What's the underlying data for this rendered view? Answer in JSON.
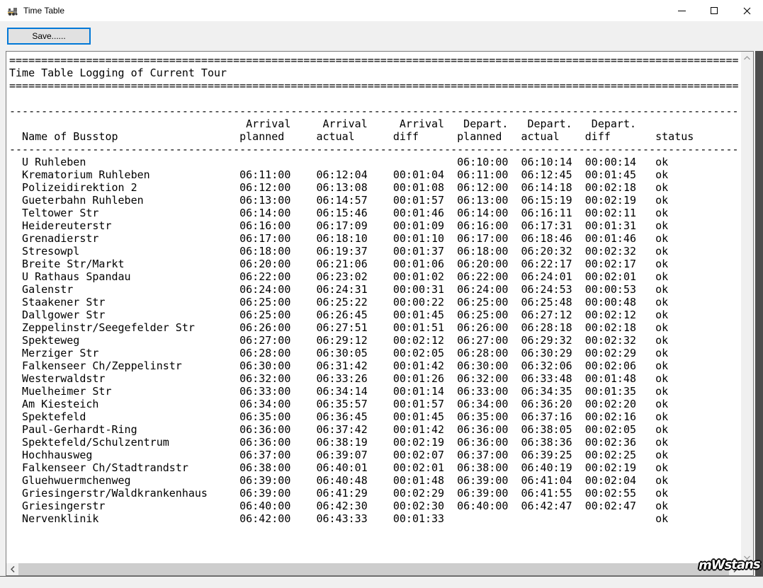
{
  "window": {
    "title": "Time Table"
  },
  "toolbar": {
    "save_label": "Save......"
  },
  "report": {
    "title_line": "Time Table Logging of Current Tour",
    "separator_heavy": {
      "char": "=",
      "count": 114
    },
    "separator_light": {
      "char": "-",
      "count": 114
    },
    "columns": {
      "name_header": "Name of Busstop",
      "groups": [
        [
          "Arrival",
          "planned"
        ],
        [
          "Arrival",
          "actual"
        ],
        [
          "Arrival",
          "diff"
        ],
        [
          "Depart.",
          "planned"
        ],
        [
          "Depart.",
          "actual"
        ],
        [
          "Depart.",
          "diff"
        ]
      ],
      "status_header": "status"
    },
    "rows": [
      [
        "U Ruhleben",
        "",
        "",
        "",
        "06:10:00",
        "06:10:14",
        "00:00:14",
        "ok"
      ],
      [
        "Krematorium Ruhleben",
        "06:11:00",
        "06:12:04",
        "00:01:04",
        "06:11:00",
        "06:12:45",
        "00:01:45",
        "ok"
      ],
      [
        "Polizeidirektion 2",
        "06:12:00",
        "06:13:08",
        "00:01:08",
        "06:12:00",
        "06:14:18",
        "00:02:18",
        "ok"
      ],
      [
        "Gueterbahn Ruhleben",
        "06:13:00",
        "06:14:57",
        "00:01:57",
        "06:13:00",
        "06:15:19",
        "00:02:19",
        "ok"
      ],
      [
        "Teltower Str",
        "06:14:00",
        "06:15:46",
        "00:01:46",
        "06:14:00",
        "06:16:11",
        "00:02:11",
        "ok"
      ],
      [
        "Heidereuterstr",
        "06:16:00",
        "06:17:09",
        "00:01:09",
        "06:16:00",
        "06:17:31",
        "00:01:31",
        "ok"
      ],
      [
        "Grenadierstr",
        "06:17:00",
        "06:18:10",
        "00:01:10",
        "06:17:00",
        "06:18:46",
        "00:01:46",
        "ok"
      ],
      [
        "Stresowpl",
        "06:18:00",
        "06:19:37",
        "00:01:37",
        "06:18:00",
        "06:20:32",
        "00:02:32",
        "ok"
      ],
      [
        "Breite Str/Markt",
        "06:20:00",
        "06:21:06",
        "00:01:06",
        "06:20:00",
        "06:22:17",
        "00:02:17",
        "ok"
      ],
      [
        "U Rathaus Spandau",
        "06:22:00",
        "06:23:02",
        "00:01:02",
        "06:22:00",
        "06:24:01",
        "00:02:01",
        "ok"
      ],
      [
        "Galenstr",
        "06:24:00",
        "06:24:31",
        "00:00:31",
        "06:24:00",
        "06:24:53",
        "00:00:53",
        "ok"
      ],
      [
        "Staakener Str",
        "06:25:00",
        "06:25:22",
        "00:00:22",
        "06:25:00",
        "06:25:48",
        "00:00:48",
        "ok"
      ],
      [
        "Dallgower Str",
        "06:25:00",
        "06:26:45",
        "00:01:45",
        "06:25:00",
        "06:27:12",
        "00:02:12",
        "ok"
      ],
      [
        "Zeppelinstr/Seegefelder Str",
        "06:26:00",
        "06:27:51",
        "00:01:51",
        "06:26:00",
        "06:28:18",
        "00:02:18",
        "ok"
      ],
      [
        "Spekteweg",
        "06:27:00",
        "06:29:12",
        "00:02:12",
        "06:27:00",
        "06:29:32",
        "00:02:32",
        "ok"
      ],
      [
        "Merziger Str",
        "06:28:00",
        "06:30:05",
        "00:02:05",
        "06:28:00",
        "06:30:29",
        "00:02:29",
        "ok"
      ],
      [
        "Falkenseer Ch/Zeppelinstr",
        "06:30:00",
        "06:31:42",
        "00:01:42",
        "06:30:00",
        "06:32:06",
        "00:02:06",
        "ok"
      ],
      [
        "Westerwaldstr",
        "06:32:00",
        "06:33:26",
        "00:01:26",
        "06:32:00",
        "06:33:48",
        "00:01:48",
        "ok"
      ],
      [
        "Muelheimer Str",
        "06:33:00",
        "06:34:14",
        "00:01:14",
        "06:33:00",
        "06:34:35",
        "00:01:35",
        "ok"
      ],
      [
        "Am Kiesteich",
        "06:34:00",
        "06:35:57",
        "00:01:57",
        "06:34:00",
        "06:36:20",
        "00:02:20",
        "ok"
      ],
      [
        "Spektefeld",
        "06:35:00",
        "06:36:45",
        "00:01:45",
        "06:35:00",
        "06:37:16",
        "00:02:16",
        "ok"
      ],
      [
        "Paul-Gerhardt-Ring",
        "06:36:00",
        "06:37:42",
        "00:01:42",
        "06:36:00",
        "06:38:05",
        "00:02:05",
        "ok"
      ],
      [
        "Spektefeld/Schulzentrum",
        "06:36:00",
        "06:38:19",
        "00:02:19",
        "06:36:00",
        "06:38:36",
        "00:02:36",
        "ok"
      ],
      [
        "Hochhausweg",
        "06:37:00",
        "06:39:07",
        "00:02:07",
        "06:37:00",
        "06:39:25",
        "00:02:25",
        "ok"
      ],
      [
        "Falkenseer Ch/Stadtrandstr",
        "06:38:00",
        "06:40:01",
        "00:02:01",
        "06:38:00",
        "06:40:19",
        "00:02:19",
        "ok"
      ],
      [
        "Gluehwuermchenweg",
        "06:39:00",
        "06:40:48",
        "00:01:48",
        "06:39:00",
        "06:41:04",
        "00:02:04",
        "ok"
      ],
      [
        "Griesingerstr/Waldkrankenhaus",
        "06:39:00",
        "06:41:29",
        "00:02:29",
        "06:39:00",
        "06:41:55",
        "00:02:55",
        "ok"
      ],
      [
        "Griesingerstr",
        "06:40:00",
        "06:42:30",
        "00:02:30",
        "06:40:00",
        "06:42:47",
        "00:02:47",
        "ok"
      ],
      [
        "Nervenklinik",
        "06:42:00",
        "06:43:33",
        "00:01:33",
        "",
        "",
        "",
        "ok"
      ]
    ]
  },
  "watermark": "mWstans"
}
